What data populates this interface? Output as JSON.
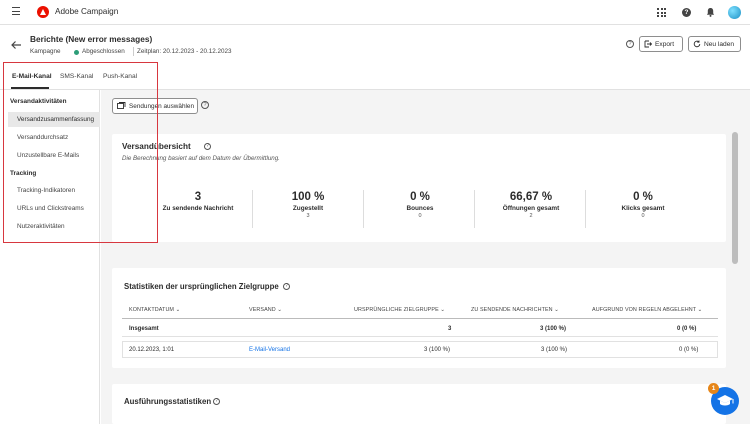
{
  "app": {
    "name": "Adobe Campaign"
  },
  "header": {
    "title": "Berichte (New error messages)",
    "type": "Kampagne",
    "status": "Abgeschlossen",
    "status_color": "#2d9d78",
    "schedule": "Zeitplan: 20.12.2023 - 20.12.2023",
    "export_label": "Export",
    "reload_label": "Neu laden"
  },
  "tabs": [
    {
      "label": "E-Mail-Kanal",
      "active": true
    },
    {
      "label": "SMS-Kanal",
      "active": false
    },
    {
      "label": "Push-Kanal",
      "active": false
    }
  ],
  "sidebar": {
    "groups": [
      {
        "label": "Versandaktivitäten",
        "items": [
          {
            "label": "Versandzusammenfassung",
            "active": true
          },
          {
            "label": "Versanddurchsatz",
            "active": false
          },
          {
            "label": "Unzustellbare E-Mails",
            "active": false
          }
        ]
      },
      {
        "label": "Tracking",
        "items": [
          {
            "label": "Tracking-Indikatoren",
            "active": false
          },
          {
            "label": "URLs und Clickstreams",
            "active": false
          },
          {
            "label": "Nutzeraktivitäten",
            "active": false
          }
        ]
      }
    ]
  },
  "toolbar": {
    "select_deliveries": "Sendungen auswählen"
  },
  "overview": {
    "title": "Versandübersicht",
    "subtitle": "Die Berechnung basiert auf dem Datum der Übermittlung.",
    "kpis": [
      {
        "value": "3",
        "label": "Zu sendende Nachricht",
        "sub": ""
      },
      {
        "value": "100 %",
        "label": "Zugestellt",
        "sub": "3"
      },
      {
        "value": "0 %",
        "label": "Bounces",
        "sub": "0"
      },
      {
        "value": "66,67 %",
        "label": "Öffnungen gesamt",
        "sub": "2"
      },
      {
        "value": "0 %",
        "label": "Klicks gesamt",
        "sub": "0"
      }
    ]
  },
  "stats": {
    "title": "Statistiken der ursprünglichen Zielgruppe",
    "columns": [
      "KONTAKTDATUM",
      "VERSAND",
      "URSPRÜNGLICHE ZIELGRUPPE",
      "ZU SENDENDE NACHRICHTEN",
      "AUFGRUND VON REGELN ABGELEHNT"
    ],
    "total": {
      "label": "Insgesamt",
      "target": "3",
      "to_send": "3 (100 %)",
      "rejected": "0 (0 %)"
    },
    "rows": [
      {
        "date": "20.12.2023, 1:01",
        "delivery": "E-Mail-Versand",
        "target": "3 (100 %)",
        "to_send": "3 (100 %)",
        "rejected": "0 (0 %)"
      }
    ]
  },
  "execution": {
    "title": "Ausführungsstatistiken"
  },
  "chat": {
    "badge": "1"
  },
  "colors": {
    "accent": "#1473e6",
    "highlight": "#d7373f",
    "brand": "#eb1000"
  }
}
